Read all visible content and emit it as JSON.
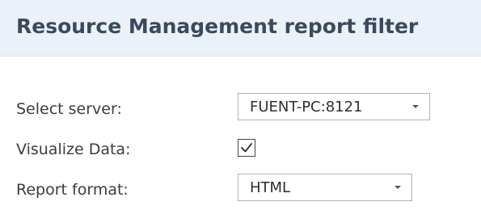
{
  "header": {
    "title": "Resource Management report filter"
  },
  "form": {
    "server": {
      "label": "Select server:",
      "value": "FUENT-PC:8121"
    },
    "visualize": {
      "label": "Visualize Data:",
      "checked": true
    },
    "format": {
      "label": "Report format:",
      "value": "HTML"
    }
  },
  "colors": {
    "header_background": "#ebf1f8",
    "title_text": "#3a4a5e",
    "field_border": "#a9b2bd"
  }
}
